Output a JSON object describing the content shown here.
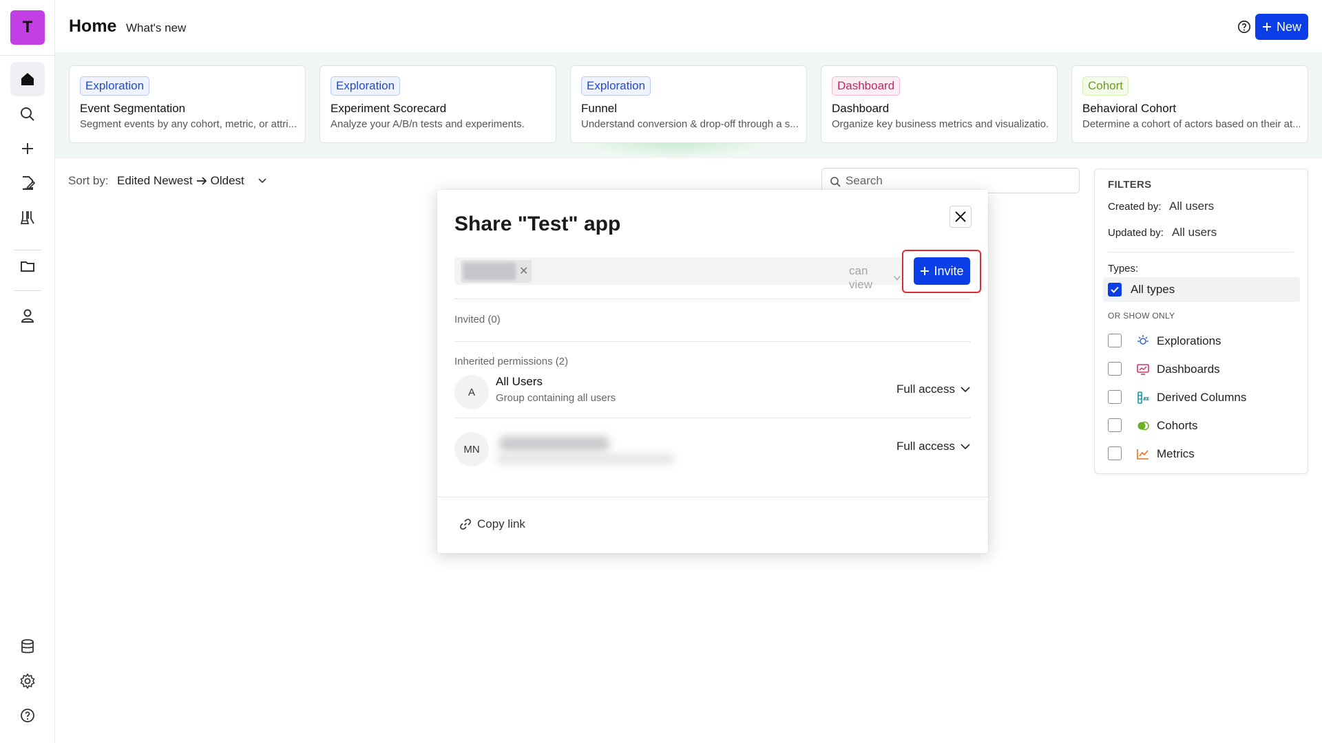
{
  "app": {
    "workspace_initial": "T",
    "page_title": "Home",
    "whats_new": "What's new",
    "new_button": "New"
  },
  "nav": {
    "items": [
      {
        "name": "home-icon",
        "active": true
      },
      {
        "name": "search-icon"
      },
      {
        "name": "plus-icon"
      },
      {
        "name": "edit-document-icon"
      },
      {
        "name": "lab-icon"
      },
      {
        "name": "folder-icon"
      },
      {
        "name": "user-icon"
      },
      {
        "name": "database-icon"
      },
      {
        "name": "gear-icon"
      },
      {
        "name": "help-icon"
      }
    ]
  },
  "cards": [
    {
      "badge": "Exploration",
      "type": "exploration",
      "title": "Event Segmentation",
      "desc": "Segment events by any cohort, metric, or attri..."
    },
    {
      "badge": "Exploration",
      "type": "exploration",
      "title": "Experiment Scorecard",
      "desc": "Analyze your A/B/n tests and experiments."
    },
    {
      "badge": "Exploration",
      "type": "exploration",
      "title": "Funnel",
      "desc": "Understand conversion & drop-off through a s..."
    },
    {
      "badge": "Dashboard",
      "type": "dashboard",
      "title": "Dashboard",
      "desc": "Organize key business metrics and visualizatio..."
    },
    {
      "badge": "Cohort",
      "type": "cohort",
      "title": "Behavioral Cohort",
      "desc": "Determine a cohort of actors based on their at..."
    }
  ],
  "sort": {
    "label": "Sort by:",
    "value_from": "Edited Newest",
    "value_to": "Oldest"
  },
  "search": {
    "placeholder": "Search"
  },
  "filters": {
    "heading": "FILTERS",
    "created_by_label": "Created by:",
    "created_by_value": "All users",
    "updated_by_label": "Updated by:",
    "updated_by_value": "All users",
    "types_label": "Types:",
    "all_types": "All types",
    "or_show_only": "OR SHOW ONLY",
    "options": [
      {
        "label": "Explorations",
        "icon": "exploration-icon",
        "color": "#3b63d9"
      },
      {
        "label": "Dashboards",
        "icon": "dashboard-icon",
        "color": "#d6336c"
      },
      {
        "label": "Derived Columns",
        "icon": "derived-column-icon",
        "color": "#0f9aa8"
      },
      {
        "label": "Cohorts",
        "icon": "cohort-icon",
        "color": "#6ab023"
      },
      {
        "label": "Metrics",
        "icon": "metric-icon",
        "color": "#e8701a"
      }
    ]
  },
  "share_modal": {
    "title": "Share \"Test\" app",
    "permission_select": "can view",
    "invite_button": "Invite",
    "invited_label": "Invited (0)",
    "inherited_label": "Inherited permissions (2)",
    "rows": [
      {
        "initials": "A",
        "name": "All Users",
        "subtitle": "Group containing all users",
        "access": "Full access"
      },
      {
        "initials": "MN",
        "name": "",
        "subtitle": "",
        "access": "Full access"
      }
    ],
    "copy_link": "Copy link"
  },
  "colors": {
    "accent": "#0b3ee6",
    "workspace_avatar": "#c23fe6",
    "highlight": "#e0282e",
    "band": "#f1f8f3"
  }
}
